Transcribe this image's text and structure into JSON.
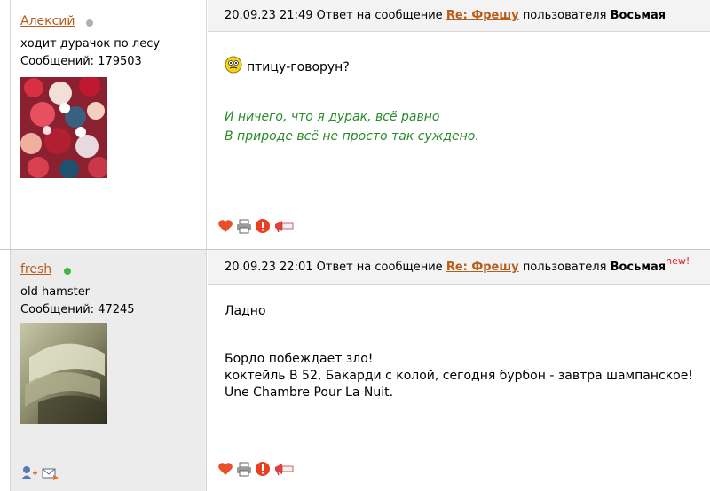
{
  "posts": [
    {
      "author": "Алексий",
      "online": false,
      "status_line": "ходит дурачок по лесу",
      "messages_label": "Сообщений:",
      "messages_count": "179503",
      "date": "20.09.23 21:49",
      "reply_prefix": "Ответ на сообщение",
      "reply_link": "Re: Фрешу",
      "reply_user_prefix": "пользователя",
      "reply_user": "Восьмая",
      "new_badge": "",
      "text": "птицу-говорун?",
      "signature_lines": [
        "И ничего, что я дурак, всё равно",
        "В природе всё не просто так суждено."
      ]
    },
    {
      "author": "fresh",
      "online": true,
      "status_line": "old hamster",
      "messages_label": "Сообщений:",
      "messages_count": "47245",
      "date": "20.09.23 22:01",
      "reply_prefix": "Ответ на сообщение",
      "reply_link": "Re: Фрешу",
      "reply_user_prefix": "пользователя",
      "reply_user": "Восьмая",
      "new_badge": "new!",
      "text": "Ладно",
      "signature_lines": [
        "Бордо побеждает зло!",
        "коктейль В 52, Бакарди с колой, сегодня бурбон - завтра шампанское!",
        "Une Chambre Pour La Nuit."
      ]
    }
  ],
  "colors": {
    "link": "#b85c1a",
    "quote_green": "#2a8a2a",
    "online": "#3cb93c",
    "offline": "#b0b0b0",
    "new": "#e02020"
  },
  "icons": [
    "heart-icon",
    "print-icon",
    "warning-icon",
    "megaphone-icon",
    "add-friend-icon",
    "send-message-icon",
    "confused-smiley-icon"
  ]
}
